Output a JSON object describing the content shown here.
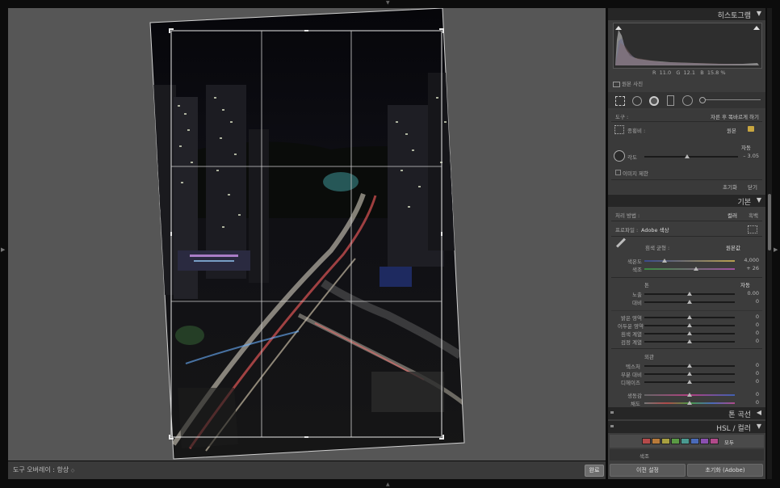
{
  "histogram": {
    "title": "히스토그램",
    "r_label": "R",
    "r_value": "11.0",
    "g_label": "G",
    "g_value": "12.1",
    "b_label": "B",
    "b_value": "15.8",
    "percent": "%",
    "original_photo": "원본 사진"
  },
  "crop": {
    "tool_label": "도구 :",
    "tool_value": "자른 후 똑바르게 하기",
    "aspect_label": "종횡비 :",
    "aspect_value": "원본",
    "auto_label": "자동",
    "angle_label": "각도",
    "angle_value": "– 3.05",
    "constrain_label": "이미지 제한",
    "reset_label": "초기화",
    "close_label": "닫기"
  },
  "basic": {
    "title": "기본",
    "treatment_label": "처리 방법 :",
    "color_label": "컬러",
    "bw_label": "흑백",
    "profile_label": "프로파일 :",
    "profile_value": "Adobe 색상",
    "wb_label": "흰색 균형 :",
    "wb_value": "원본값",
    "temp_label": "색온도",
    "temp_value": "4,000",
    "tint_label": "색조",
    "tint_value": "+ 26",
    "tone_label": "톤",
    "tone_auto": "자동",
    "exposure_label": "노출",
    "exposure_value": "0.00",
    "contrast_label": "대비",
    "contrast_value": "0",
    "highlights_label": "밝은 영역",
    "highlights_value": "0",
    "shadows_label": "어두운 영역",
    "shadows_value": "0",
    "whites_label": "흰색 계열",
    "whites_value": "0",
    "blacks_label": "검정 계열",
    "blacks_value": "0",
    "presence_label": "외관",
    "texture_label": "텍스처",
    "texture_value": "0",
    "clarity_label": "부분 대비",
    "clarity_value": "0",
    "dehaze_label": "디헤이즈",
    "dehaze_value": "0",
    "vibrance_label": "생동감",
    "vibrance_value": "0",
    "saturation_label": "채도",
    "saturation_value": "0"
  },
  "tone_curve": {
    "title": "톤 곡선"
  },
  "hsl": {
    "title": "HSL / 컬러",
    "all_label": "모두",
    "hue_label": "색조",
    "swatches": [
      "#b44a4a",
      "#b87a3a",
      "#a8a040",
      "#5a9a44",
      "#4a9a90",
      "#4a6ab8",
      "#8a50b0",
      "#b04a8a"
    ]
  },
  "footer": {
    "prev_label": "이전 설정",
    "reset_label": "초기화 (Adobe)"
  },
  "toolbar": {
    "overlay_label": "도구 오버레이 :",
    "overlay_value": "항상",
    "done_label": "완료"
  }
}
